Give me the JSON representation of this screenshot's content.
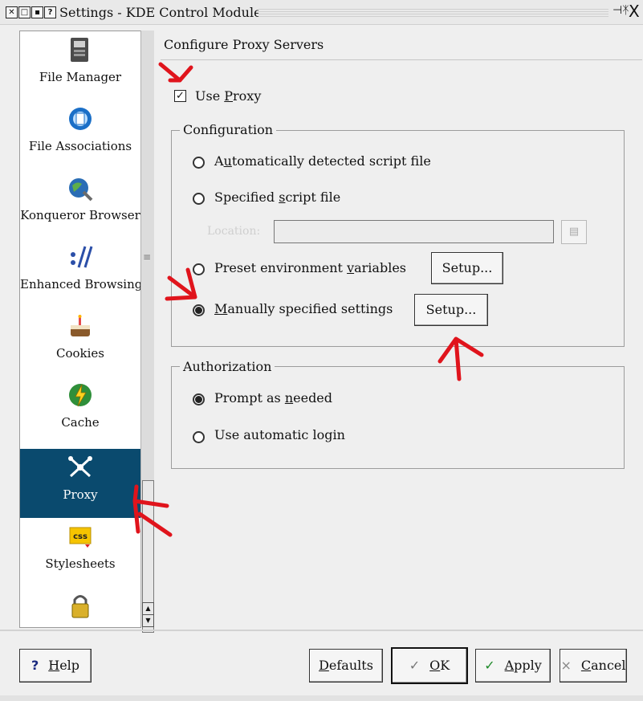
{
  "window": {
    "title": "Settings - KDE Control Module",
    "title_buttons": [
      "✕",
      "□",
      "▪",
      "?"
    ],
    "pin_glyph": "⊣ᛡ",
    "close_glyph": "X"
  },
  "sidebar": {
    "items": [
      {
        "label": "File Manager",
        "icon": "file-manager-icon",
        "selected": false
      },
      {
        "label": "File Associations",
        "icon": "file-associations-icon",
        "selected": false
      },
      {
        "label": "Konqueror Browser",
        "icon": "konqueror-browser-icon",
        "selected": false
      },
      {
        "label": "Enhanced Browsing",
        "icon": "enhanced-browsing-icon",
        "selected": false
      },
      {
        "label": "Cookies",
        "icon": "cookies-icon",
        "selected": false
      },
      {
        "label": "Cache",
        "icon": "cache-icon",
        "selected": false
      },
      {
        "label": "Proxy",
        "icon": "proxy-icon",
        "selected": true
      },
      {
        "label": "Stylesheets",
        "icon": "stylesheets-icon",
        "selected": false
      }
    ],
    "selected_bg": "#0a4a6e"
  },
  "panel": {
    "title": "Configure Proxy Servers",
    "use_proxy": {
      "label_pre": "Use ",
      "label_u": "P",
      "label_post": "roxy",
      "checked": true
    },
    "configuration": {
      "title": "Configuration",
      "auto_script": {
        "pre": "A",
        "u": "u",
        "post": "tomatically detected script file",
        "selected": false
      },
      "specified_script": {
        "pre": "Specified ",
        "u": "s",
        "post": "cript file",
        "selected": false
      },
      "location_label": "Location:",
      "location_value": "",
      "preset_env": {
        "pre": "Preset environment ",
        "u": "v",
        "post": "ariables",
        "selected": false
      },
      "manual": {
        "pre": "",
        "u": "M",
        "post": "anually specified settings",
        "selected": true
      },
      "setup_label": "Setup..."
    },
    "authorization": {
      "title": "Authorization",
      "prompt": {
        "pre": "Prompt as ",
        "u": "n",
        "post": "eeded",
        "selected": true
      },
      "auto_login": {
        "pre": "Use automatic login",
        "selected": false
      }
    }
  },
  "buttons": {
    "help": {
      "icon": "?",
      "u": "H",
      "post": "elp"
    },
    "defaults": {
      "u": "D",
      "post": "efaults"
    },
    "ok": {
      "icon": "✓",
      "u": "O",
      "post": "K"
    },
    "apply": {
      "icon": "✓",
      "u": "A",
      "post": "pply"
    },
    "cancel": {
      "icon": "×",
      "u": "C",
      "post": "ancel"
    }
  },
  "annotation_color": "#e0141c"
}
